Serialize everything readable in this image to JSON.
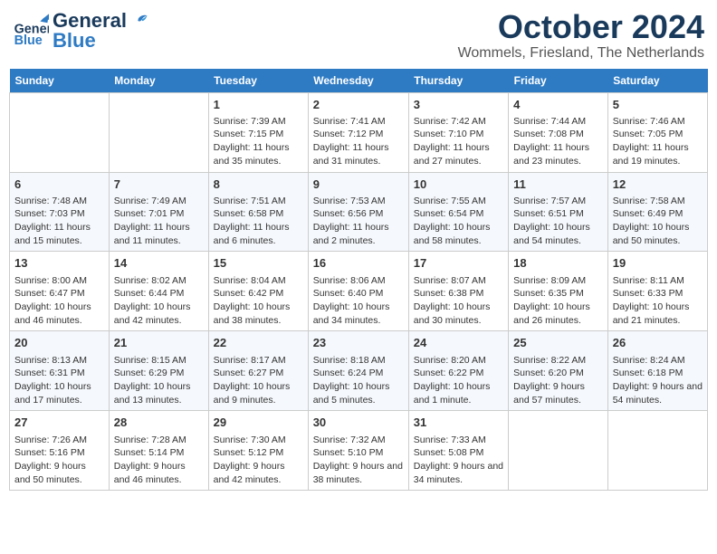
{
  "header": {
    "logo_general": "General",
    "logo_blue": "Blue",
    "month": "October 2024",
    "location": "Wommels, Friesland, The Netherlands"
  },
  "days_of_week": [
    "Sunday",
    "Monday",
    "Tuesday",
    "Wednesday",
    "Thursday",
    "Friday",
    "Saturday"
  ],
  "weeks": [
    [
      {
        "day": "",
        "info": ""
      },
      {
        "day": "",
        "info": ""
      },
      {
        "day": "1",
        "info": "Sunrise: 7:39 AM\nSunset: 7:15 PM\nDaylight: 11 hours and 35 minutes."
      },
      {
        "day": "2",
        "info": "Sunrise: 7:41 AM\nSunset: 7:12 PM\nDaylight: 11 hours and 31 minutes."
      },
      {
        "day": "3",
        "info": "Sunrise: 7:42 AM\nSunset: 7:10 PM\nDaylight: 11 hours and 27 minutes."
      },
      {
        "day": "4",
        "info": "Sunrise: 7:44 AM\nSunset: 7:08 PM\nDaylight: 11 hours and 23 minutes."
      },
      {
        "day": "5",
        "info": "Sunrise: 7:46 AM\nSunset: 7:05 PM\nDaylight: 11 hours and 19 minutes."
      }
    ],
    [
      {
        "day": "6",
        "info": "Sunrise: 7:48 AM\nSunset: 7:03 PM\nDaylight: 11 hours and 15 minutes."
      },
      {
        "day": "7",
        "info": "Sunrise: 7:49 AM\nSunset: 7:01 PM\nDaylight: 11 hours and 11 minutes."
      },
      {
        "day": "8",
        "info": "Sunrise: 7:51 AM\nSunset: 6:58 PM\nDaylight: 11 hours and 6 minutes."
      },
      {
        "day": "9",
        "info": "Sunrise: 7:53 AM\nSunset: 6:56 PM\nDaylight: 11 hours and 2 minutes."
      },
      {
        "day": "10",
        "info": "Sunrise: 7:55 AM\nSunset: 6:54 PM\nDaylight: 10 hours and 58 minutes."
      },
      {
        "day": "11",
        "info": "Sunrise: 7:57 AM\nSunset: 6:51 PM\nDaylight: 10 hours and 54 minutes."
      },
      {
        "day": "12",
        "info": "Sunrise: 7:58 AM\nSunset: 6:49 PM\nDaylight: 10 hours and 50 minutes."
      }
    ],
    [
      {
        "day": "13",
        "info": "Sunrise: 8:00 AM\nSunset: 6:47 PM\nDaylight: 10 hours and 46 minutes."
      },
      {
        "day": "14",
        "info": "Sunrise: 8:02 AM\nSunset: 6:44 PM\nDaylight: 10 hours and 42 minutes."
      },
      {
        "day": "15",
        "info": "Sunrise: 8:04 AM\nSunset: 6:42 PM\nDaylight: 10 hours and 38 minutes."
      },
      {
        "day": "16",
        "info": "Sunrise: 8:06 AM\nSunset: 6:40 PM\nDaylight: 10 hours and 34 minutes."
      },
      {
        "day": "17",
        "info": "Sunrise: 8:07 AM\nSunset: 6:38 PM\nDaylight: 10 hours and 30 minutes."
      },
      {
        "day": "18",
        "info": "Sunrise: 8:09 AM\nSunset: 6:35 PM\nDaylight: 10 hours and 26 minutes."
      },
      {
        "day": "19",
        "info": "Sunrise: 8:11 AM\nSunset: 6:33 PM\nDaylight: 10 hours and 21 minutes."
      }
    ],
    [
      {
        "day": "20",
        "info": "Sunrise: 8:13 AM\nSunset: 6:31 PM\nDaylight: 10 hours and 17 minutes."
      },
      {
        "day": "21",
        "info": "Sunrise: 8:15 AM\nSunset: 6:29 PM\nDaylight: 10 hours and 13 minutes."
      },
      {
        "day": "22",
        "info": "Sunrise: 8:17 AM\nSunset: 6:27 PM\nDaylight: 10 hours and 9 minutes."
      },
      {
        "day": "23",
        "info": "Sunrise: 8:18 AM\nSunset: 6:24 PM\nDaylight: 10 hours and 5 minutes."
      },
      {
        "day": "24",
        "info": "Sunrise: 8:20 AM\nSunset: 6:22 PM\nDaylight: 10 hours and 1 minute."
      },
      {
        "day": "25",
        "info": "Sunrise: 8:22 AM\nSunset: 6:20 PM\nDaylight: 9 hours and 57 minutes."
      },
      {
        "day": "26",
        "info": "Sunrise: 8:24 AM\nSunset: 6:18 PM\nDaylight: 9 hours and 54 minutes."
      }
    ],
    [
      {
        "day": "27",
        "info": "Sunrise: 7:26 AM\nSunset: 5:16 PM\nDaylight: 9 hours and 50 minutes."
      },
      {
        "day": "28",
        "info": "Sunrise: 7:28 AM\nSunset: 5:14 PM\nDaylight: 9 hours and 46 minutes."
      },
      {
        "day": "29",
        "info": "Sunrise: 7:30 AM\nSunset: 5:12 PM\nDaylight: 9 hours and 42 minutes."
      },
      {
        "day": "30",
        "info": "Sunrise: 7:32 AM\nSunset: 5:10 PM\nDaylight: 9 hours and 38 minutes."
      },
      {
        "day": "31",
        "info": "Sunrise: 7:33 AM\nSunset: 5:08 PM\nDaylight: 9 hours and 34 minutes."
      },
      {
        "day": "",
        "info": ""
      },
      {
        "day": "",
        "info": ""
      }
    ]
  ]
}
